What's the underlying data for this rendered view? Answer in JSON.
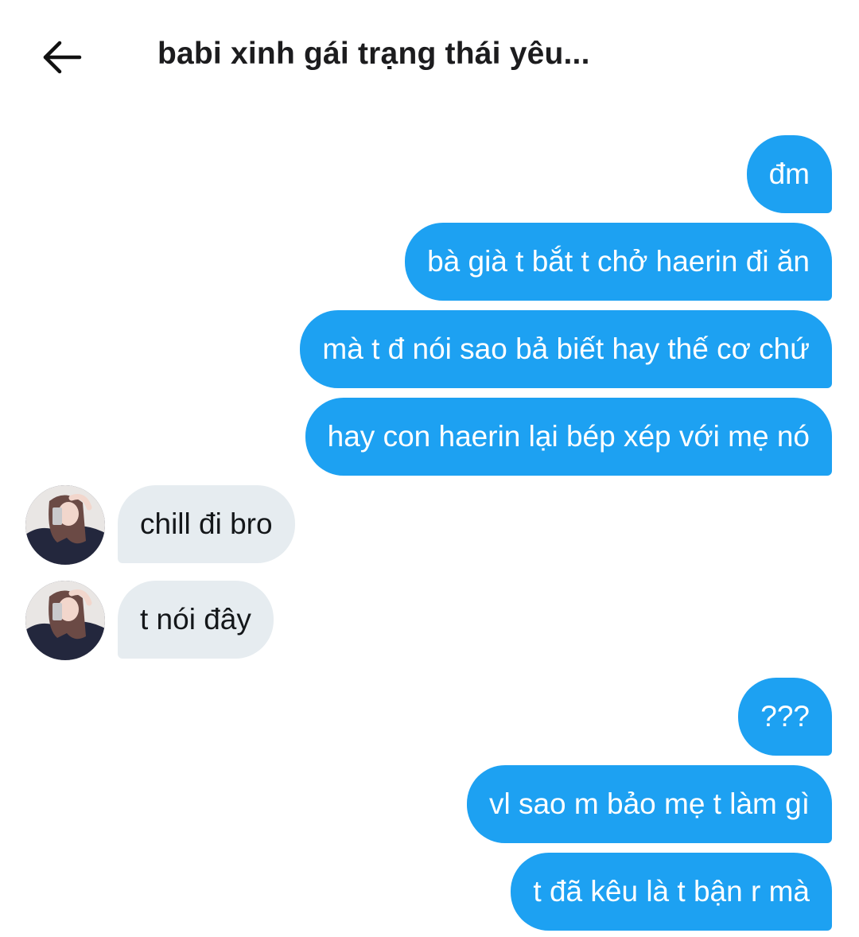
{
  "header": {
    "title": "babi xinh gái trạng thái yêu..."
  },
  "messages": [
    {
      "side": "out",
      "text": "đm"
    },
    {
      "side": "out",
      "text": "bà già t bắt t chở haerin đi ăn"
    },
    {
      "side": "out",
      "text": "mà t đ nói sao bả biết hay thế cơ chứ"
    },
    {
      "side": "out",
      "text": "hay con haerin lại bép xép với mẹ nó"
    },
    {
      "side": "in",
      "text": "chill đi bro"
    },
    {
      "side": "in",
      "text": "t nói đây"
    },
    {
      "side": "out",
      "text": "???"
    },
    {
      "side": "out",
      "text": "vl sao m bảo mẹ t làm gì"
    },
    {
      "side": "out",
      "text": "t đã kêu là t bận r mà"
    }
  ],
  "colors": {
    "outgoing_bubble": "#1da1f2",
    "incoming_bubble": "#e6ecf0"
  },
  "icons": {
    "back": "arrow-left-icon"
  }
}
